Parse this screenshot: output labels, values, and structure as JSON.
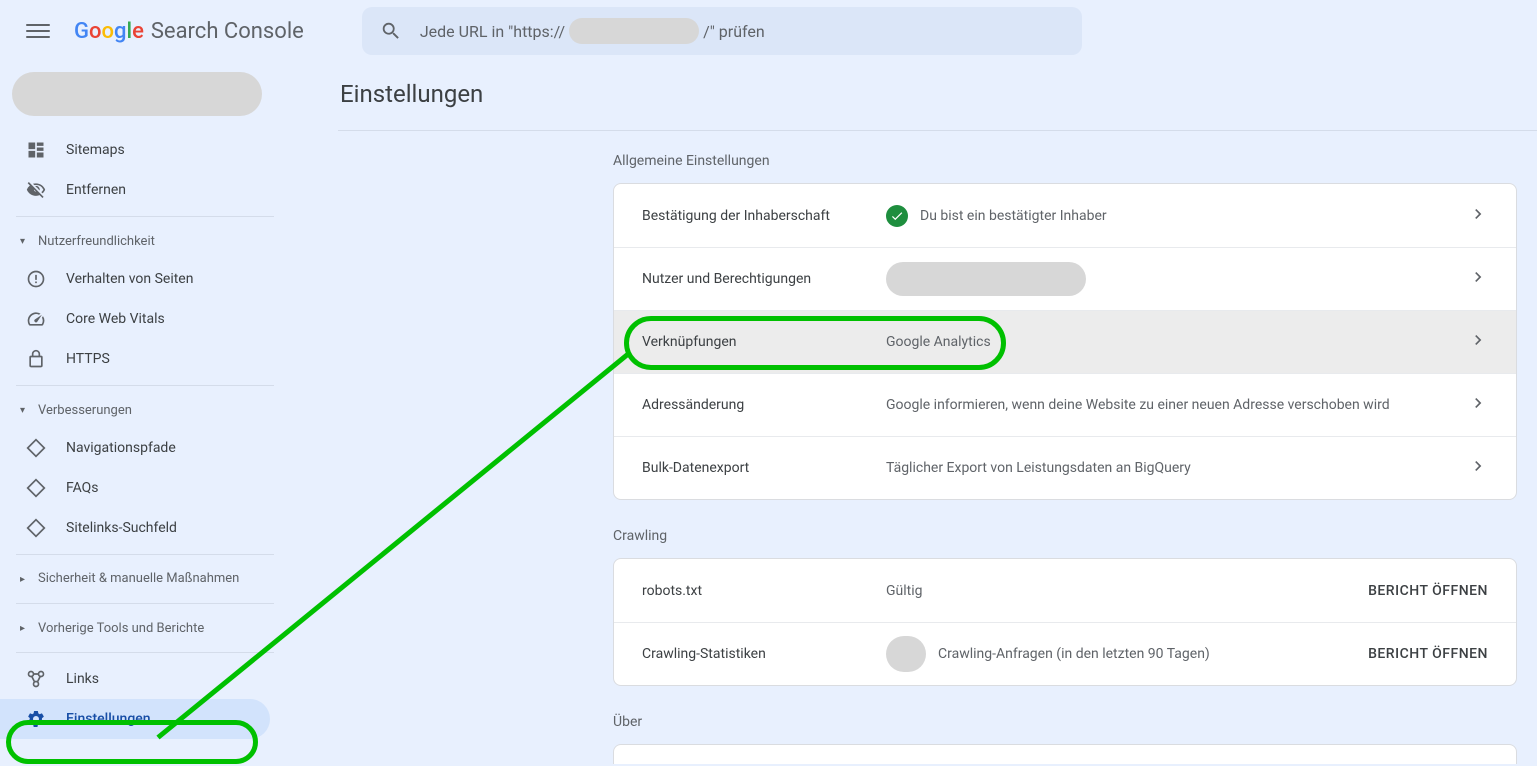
{
  "header": {
    "product": "Search Console",
    "search_prefix": "Jede URL in \"https://",
    "search_suffix": "/\" prüfen"
  },
  "sidebar": {
    "items": {
      "sitemaps": "Sitemaps",
      "entfernen": "Entfernen"
    },
    "sections": {
      "nutzerfreundlichkeit": "Nutzerfreundlichkeit",
      "verbesserungen": "Verbesserungen",
      "sicherheit": "Sicherheit & manuelle Maßnahmen",
      "vorherige": "Vorherige Tools und Berichte"
    },
    "nutz_items": {
      "verhalten": "Verhalten von Seiten",
      "cwv": "Core Web Vitals",
      "https": "HTTPS"
    },
    "verb_items": {
      "nav": "Navigationspfade",
      "faqs": "FAQs",
      "sitelinks": "Sitelinks-Suchfeld"
    },
    "bottom": {
      "links": "Links",
      "einstellungen": "Einstellungen"
    }
  },
  "main": {
    "title": "Einstellungen",
    "section_general": "Allgemeine Einstellungen",
    "section_crawling": "Crawling",
    "section_about": "Über",
    "rows": {
      "ownership": {
        "title": "Bestätigung der Inhaberschaft",
        "desc": "Du bist ein bestätigter Inhaber"
      },
      "users": {
        "title": "Nutzer und Berechtigungen"
      },
      "associations": {
        "title": "Verknüpfungen",
        "desc": "Google Analytics"
      },
      "address": {
        "title": "Adressänderung",
        "desc": "Google informieren, wenn deine Website zu einer neuen Adresse verschoben wird"
      },
      "bulk": {
        "title": "Bulk-Datenexport",
        "desc": "Täglicher Export von Leistungsdaten an BigQuery"
      },
      "robots": {
        "title": "robots.txt",
        "desc": "Gültig",
        "action": "BERICHT ÖFFNEN"
      },
      "crawlstats": {
        "title": "Crawling-Statistiken",
        "desc": "Crawling-Anfragen (in den letzten 90 Tagen)",
        "action": "BERICHT ÖFFNEN"
      }
    }
  }
}
